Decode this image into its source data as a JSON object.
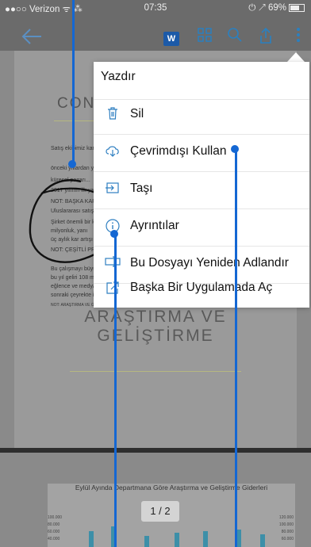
{
  "status": {
    "carrier": "●●○○ Verizon ᯤ ⁂",
    "time": "07:35",
    "right": "⏻ ↗ 69%"
  },
  "toolbar": {
    "back_icon": "back-arrow-icon",
    "word_badge": "W"
  },
  "document": {
    "con_heading": "CON",
    "small_lines": [
      "Satış ekibimiz kara",
      "önceki yıllardan y",
      "küresel pazarı...",
      "2017 yılının ilk yar",
      "NOT: BAŞKA KAR YÜZDESİ",
      "Uluslararası satış b",
      "Şirket önemli bir k",
      "milyonluk, yanı",
      "üç aylık kar artışı",
      "NOT: ÇEŞİTLİ PROBLEM",
      "Bu çalışmayı büyül",
      "bu yıl geliri 108 m",
      "eğlence ve medya",
      "sonraki çeyrekte ih",
      "NOT: ARAŞTIRMA VE GELİŞTİRME DEPARTMANI SORUNLARINA RAĞMEN, BU SENE BOYUNCA GERİDE KALDI."
    ],
    "heading_line1": "ARAŞTIRMA VE",
    "heading_line2": "GELİŞTİRME"
  },
  "chart_data": {
    "type": "bar",
    "title": "Eylül Ayında Departmana Göre Araştırma ve Geliştirme Giderleri",
    "left_ticks": [
      "100.000",
      "80.000",
      "60.000",
      "40.000"
    ],
    "right_ticks": [
      "120.000",
      "100.000",
      "80.000",
      "60.000"
    ]
  },
  "page_indicator": "1 / 2",
  "menu": {
    "items": [
      {
        "label": "Yazdır",
        "icon": ""
      },
      {
        "label": "Sil",
        "icon": "trash-icon"
      },
      {
        "label": "Çevrimdışı Kullan",
        "icon": "cloud-download-icon"
      },
      {
        "label": "Taşı",
        "icon": "move-icon"
      },
      {
        "label": "Ayrıntılar",
        "icon": "info-icon"
      },
      {
        "label": "Bu Dosyayı Yeniden Adlandır",
        "icon": "rename-icon"
      },
      {
        "label": "Başka Bir Uygulamada Aç",
        "icon": "open-in-app-icon"
      }
    ]
  }
}
